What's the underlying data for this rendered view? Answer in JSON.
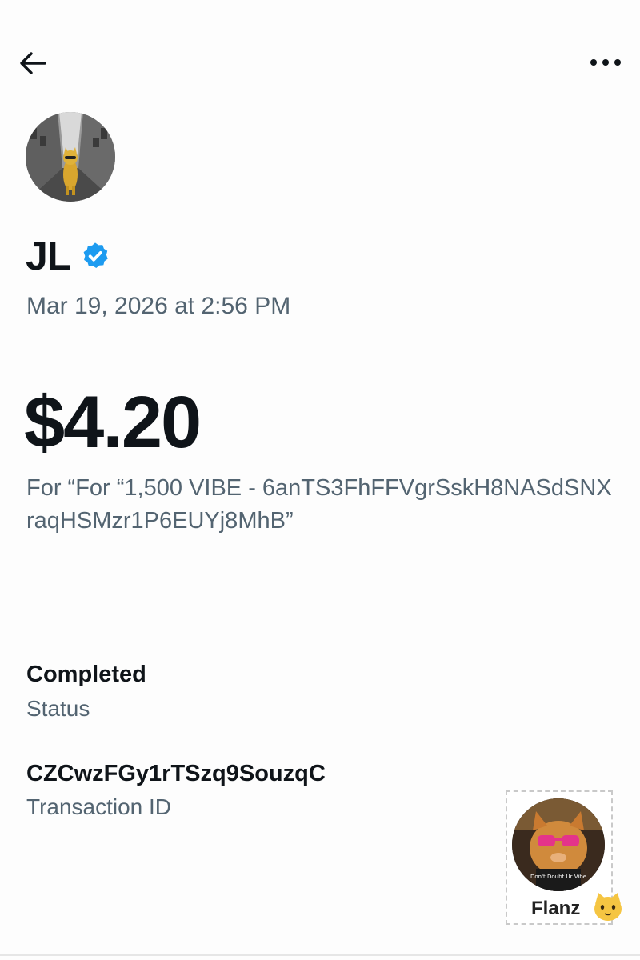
{
  "header": {
    "back_icon": "arrow-left-icon",
    "more_icon": "more-horizontal-icon"
  },
  "sender": {
    "name": "JL",
    "verified_icon": "verified-badge-icon",
    "avatar_icon": "cat-avatar"
  },
  "transaction": {
    "timestamp": "Mar 19, 2026 at 2:56 PM",
    "amount": "$4.20",
    "memo": "For “For “1,500 VIBE - 6anTS3FhFFVgrSskH8NASdSNXraqHSMzr1P6EUYj8MhB”",
    "status_value": "Completed",
    "status_label": "Status",
    "transaction_id": "CZCwzFGy1rTSzq9SouzqC",
    "transaction_id_label": "Transaction ID"
  },
  "sticker": {
    "label": "Flanz",
    "shirt_text": "Don't Doubt Ur Vibe",
    "emoji_icon": "cat-face-icon"
  },
  "colors": {
    "text_primary": "#0f1419",
    "text_secondary": "#536471",
    "verified_blue": "#1d9bf0",
    "divider": "#e4e8eb"
  }
}
